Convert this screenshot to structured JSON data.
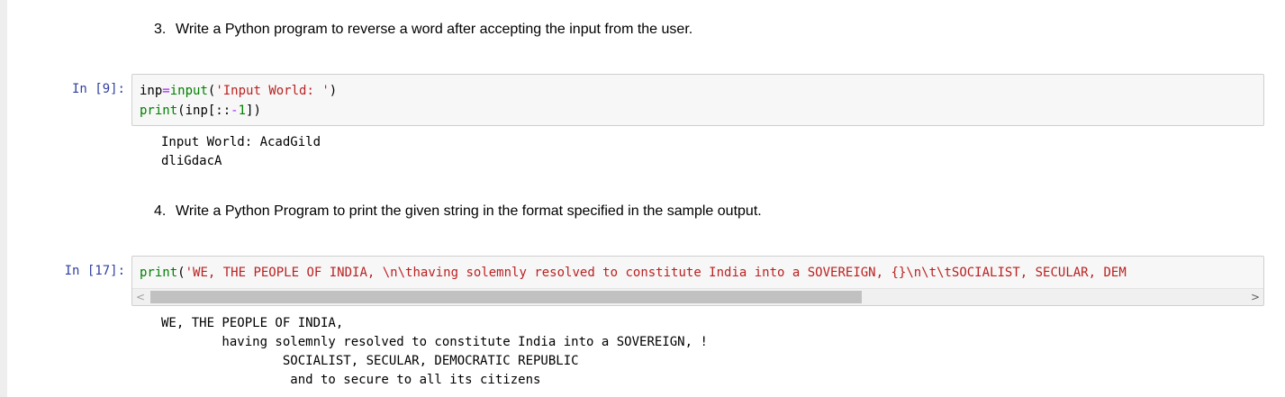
{
  "cells": [
    {
      "type": "markdown",
      "number": "3.",
      "text": "Write a Python program to reverse a word after accepting the input from the user."
    },
    {
      "type": "code",
      "prompt": "In [9]:",
      "code_lines": [
        "inp=input('Input World: ')",
        "print(inp[::-1])"
      ],
      "output_lines": [
        "Input World: AcadGild",
        "dliGdacA"
      ]
    },
    {
      "type": "markdown",
      "number": "4.",
      "text": "Write a Python Program to print the given string in the format specified in the sample output."
    },
    {
      "type": "code",
      "prompt": "In [17]:",
      "code_lines": [
        "print('WE, THE PEOPLE OF INDIA, \\n\\thaving solemnly resolved to constitute India into a SOVEREIGN, {}\\n\\t\\tSOCIALIST, SECULAR, DEM"
      ],
      "output_lines": [
        "WE, THE PEOPLE OF INDIA,",
        "        having solemnly resolved to constitute India into a SOVEREIGN, !",
        "                SOCIALIST, SECULAR, DEMOCRATIC REPUBLIC",
        "                 and to secure to all its citizens"
      ],
      "scrollbar": {
        "left_arrow": "<",
        "right_arrow": ">",
        "position_fraction": 0.0
      }
    }
  ],
  "colors": {
    "prompt": "#303f9f",
    "builtin": "#008000",
    "string": "#ba2121",
    "operator": "#aa22ff",
    "input_background": "#f7f7f7"
  }
}
